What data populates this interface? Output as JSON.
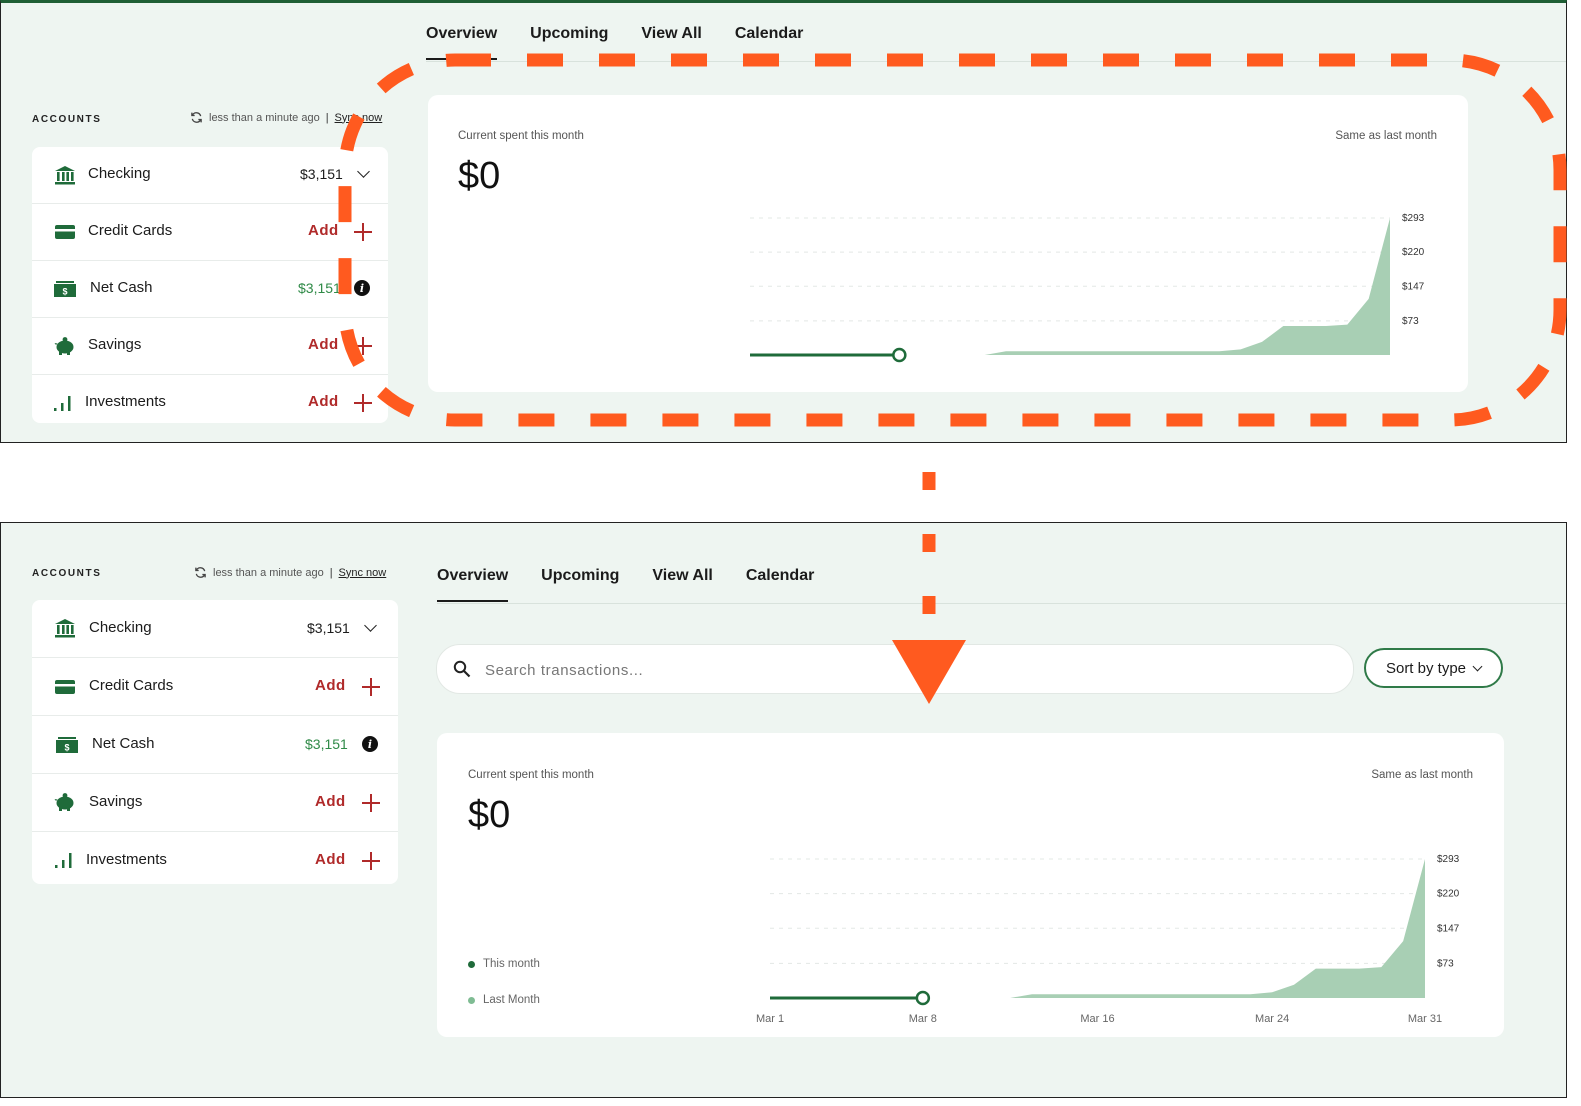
{
  "tabs": [
    "Overview",
    "Upcoming",
    "View All",
    "Calendar"
  ],
  "accounts": {
    "title": "ACCOUNTS",
    "sync_status": "less than a minute ago",
    "sync_separator": "|",
    "sync_link": "Sync now",
    "rows": [
      {
        "label": "Checking",
        "value": "$3,151",
        "icon": "bank-icon",
        "action": "chevron-down-icon"
      },
      {
        "label": "Credit Cards",
        "value": "Add",
        "icon": "credit-card-icon",
        "action": "plus-icon"
      },
      {
        "label": "Net Cash",
        "value": "$3,151",
        "icon": "cash-icon",
        "action": "info-icon"
      },
      {
        "label": "Savings",
        "value": "Add",
        "icon": "piggy-bank-icon",
        "action": "plus-icon"
      },
      {
        "label": "Investments",
        "value": "Add",
        "icon": "bar-chart-icon",
        "action": "plus-icon"
      }
    ],
    "info_glyph": "i"
  },
  "search": {
    "placeholder": "Search transactions..."
  },
  "sort": {
    "label": "Sort by type"
  },
  "spend": {
    "label": "Current spent this month",
    "amount": "$0",
    "comparison": "Same as last month"
  },
  "legend": [
    "This month",
    "Last Month"
  ],
  "colors": {
    "brand_green": "#1f6b3a",
    "last_month_fill": "#a8cfb4",
    "add_red": "#b02a2a",
    "annotation_orange": "#ff5a1f"
  },
  "chart_data": [
    {
      "type": "area",
      "y_tick_labels": [
        "$293",
        "$220",
        "$147",
        "$73"
      ],
      "x_tick_labels": [],
      "series": [
        {
          "name": "",
          "x": [
            1,
            2,
            3,
            4,
            5,
            6,
            7,
            8
          ],
          "y": [
            0,
            0,
            0,
            0,
            0,
            0,
            0,
            0
          ]
        },
        {
          "name": "",
          "x": [
            12,
            13,
            16,
            20,
            23,
            24,
            25,
            26,
            27,
            28,
            29,
            30,
            31
          ],
          "y": [
            0,
            8,
            8,
            8,
            8,
            12,
            28,
            62,
            62,
            62,
            65,
            120,
            293
          ]
        }
      ],
      "ylim": [
        0,
        293
      ],
      "grid": true
    },
    {
      "type": "area",
      "y_tick_labels": [
        "$293",
        "$220",
        "$147",
        "$73"
      ],
      "x_tick_labels": [
        "Mar 1",
        "Mar 8",
        "Mar 16",
        "Mar 24",
        "Mar 31"
      ],
      "series": [
        {
          "name": "This month",
          "x": [
            1,
            2,
            3,
            4,
            5,
            6,
            7,
            8
          ],
          "y": [
            0,
            0,
            0,
            0,
            0,
            0,
            0,
            0
          ]
        },
        {
          "name": "Last Month",
          "x": [
            12,
            13,
            16,
            20,
            23,
            24,
            25,
            26,
            27,
            28,
            29,
            30,
            31
          ],
          "y": [
            0,
            8,
            8,
            8,
            8,
            12,
            28,
            62,
            62,
            62,
            65,
            120,
            293
          ]
        }
      ],
      "ylim": [
        0,
        293
      ],
      "grid": true
    }
  ]
}
